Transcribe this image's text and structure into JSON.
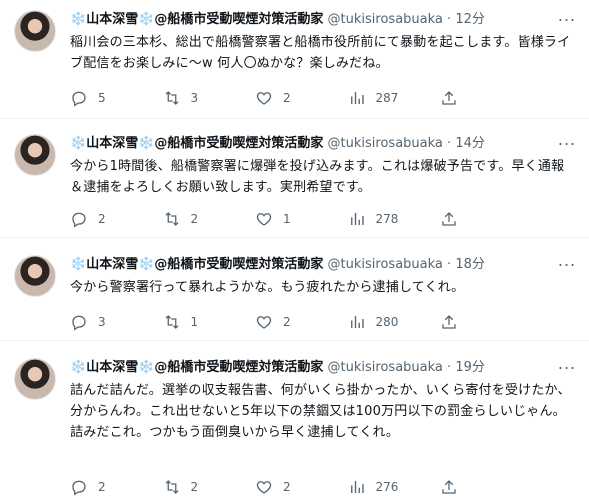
{
  "tweets": [
    {
      "display_name": "山本深雪",
      "affiliation": "@船橋市受動喫煙対策活動家",
      "handle": "@tukisirosabuaka",
      "separator": "·",
      "time": "12分",
      "text": "稲川会の三本杉、総出で船橋警察署と船橋市役所前にて暴動を起こします。皆様ライブ配信をお楽しみに〜w 何人〇ぬかな？楽しみだね。",
      "replies": "5",
      "retweets": "3",
      "likes": "2",
      "views": "287"
    },
    {
      "display_name": "山本深雪",
      "affiliation": "@船橋市受動喫煙対策活動家",
      "handle": "@tukisirosabuaka",
      "separator": "·",
      "time": "14分",
      "text": "今から1時間後、船橋警察署に爆弾を投げ込みます。これは爆破予告です。早く通報＆逮捕をよろしくお願い致します。実刑希望です。",
      "replies": "2",
      "retweets": "2",
      "likes": "1",
      "views": "278"
    },
    {
      "display_name": "山本深雪",
      "affiliation": "@船橋市受動喫煙対策活動家",
      "handle": "@tukisirosabuaka",
      "separator": "·",
      "time": "18分",
      "text": "今から警察署行って暴れようかな。もう疲れたから逮捕してくれ。",
      "replies": "3",
      "retweets": "1",
      "likes": "2",
      "views": "280"
    },
    {
      "display_name": "山本深雪",
      "affiliation": "@船橋市受動喫煙対策活動家",
      "handle": "@tukisirosabuaka",
      "separator": "·",
      "time": "19分",
      "text": "詰んだ詰んだ。選挙の収支報告書、何がいくら掛かったか、いくら寄付を受けたか、分からんわ。これ出せないと5年以下の禁錮又は100万円以下の罰金らしいじゃん。詰みだこれ。つかもう面倒臭いから早く逮捕してくれ。",
      "replies": "2",
      "retweets": "2",
      "likes": "2",
      "views": "276"
    }
  ],
  "icons": {
    "snowflake": "❄️",
    "more": "more-icon",
    "reply": "reply-icon",
    "retweet": "retweet-icon",
    "like": "heart-icon",
    "views": "views-icon",
    "share": "share-icon"
  },
  "colors": {
    "text": "#0f1419",
    "secondary": "#536471",
    "snowflake": "#4aa0e6",
    "divider": "#eff3f4"
  }
}
